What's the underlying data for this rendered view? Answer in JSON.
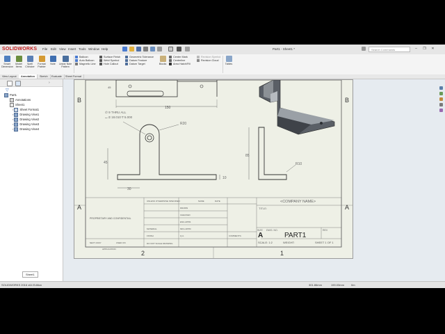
{
  "app": {
    "brand": "SOLIDWORKS",
    "document_title": "Part1 - Sheet1 *",
    "search_placeholder": "Search Commands"
  },
  "menu": [
    "File",
    "Edit",
    "View",
    "Insert",
    "Tools",
    "Window",
    "Help"
  ],
  "ribbon": {
    "big_buttons": [
      {
        "label": "Smart Dimension"
      },
      {
        "label": "Model Items"
      },
      {
        "label": "Spell Checker"
      },
      {
        "label": "Format Painter"
      },
      {
        "label": "Note"
      },
      {
        "label": "Linear Note Pattern"
      }
    ],
    "col1": [
      "Balloon",
      "Auto Balloon",
      "Magnetic Line"
    ],
    "col2": [
      "Surface Finish",
      "Weld Symbol",
      "Hole Callout"
    ],
    "col3": [
      "Geometric Tolerance",
      "Datum Feature",
      "Datum Target"
    ],
    "blocks": "Blocks",
    "col4": [
      "Center Mark",
      "Centerline",
      "Area Hatch/Fill"
    ],
    "col5": [
      "Revision Symbol",
      "Revision Cloud"
    ],
    "tables": "Tables"
  },
  "tabs": [
    "View Layout",
    "Annotation",
    "Sketch",
    "Evaluate",
    "Sheet Format"
  ],
  "active_tab": "Annotation",
  "tree": {
    "root": "Part1",
    "items": [
      "Annotations",
      "Sheet1",
      "Sheet Format1",
      "Drawing View1",
      "Drawing View2",
      "Drawing View3",
      "Drawing View4"
    ]
  },
  "sheet_tab": "Sheet1",
  "drawing": {
    "zone_letters": [
      "B",
      "A"
    ],
    "zone_numbers": [
      "2",
      "1"
    ],
    "dims": {
      "top_width": "150",
      "hole_callout_1": "∅ 9 THRU ALL",
      "hole_callout_2": "⌴ ∅ 18.010 ⊽ 5.000",
      "r20": "R20",
      "d45": "45",
      "d10": "10",
      "d30": "30",
      "d85": "85",
      "r10": "R10"
    },
    "title_block": {
      "company": "<COMPANY NAME>",
      "title_label": "TITLE:",
      "size_label": "SIZE",
      "size": "A",
      "dwg_no_label": "DWG. NO.",
      "part": "PART1",
      "rev_label": "REV",
      "scale": "SCALE: 1:2",
      "weight": "WEIGHT:",
      "sheet": "SHEET 1 OF 1",
      "proprietary": "PROPRIETARY AND CONFIDENTIAL",
      "next_assy": "NEXT ASSY",
      "used_on": "USED ON",
      "application": "APPLICATION",
      "do_not_scale": "DO NOT SCALE DRAWING",
      "material": "MATERIAL",
      "finish": "FINISH",
      "unless": "UNLESS OTHERWISE SPECIFIED:",
      "name": "NAME",
      "date": "DATE",
      "drawn": "DRAWN",
      "checked": "CHECKED",
      "eng_appr": "ENG APPR.",
      "mfg_appr": "MFG APPR.",
      "qa": "Q.A.",
      "comments": "COMMENTS:"
    }
  },
  "status": {
    "left": "SOLIDWORKS 2016 x64 Edition",
    "coords": "301.86mm",
    "coords2": "190.03mm",
    "units": "0m"
  }
}
